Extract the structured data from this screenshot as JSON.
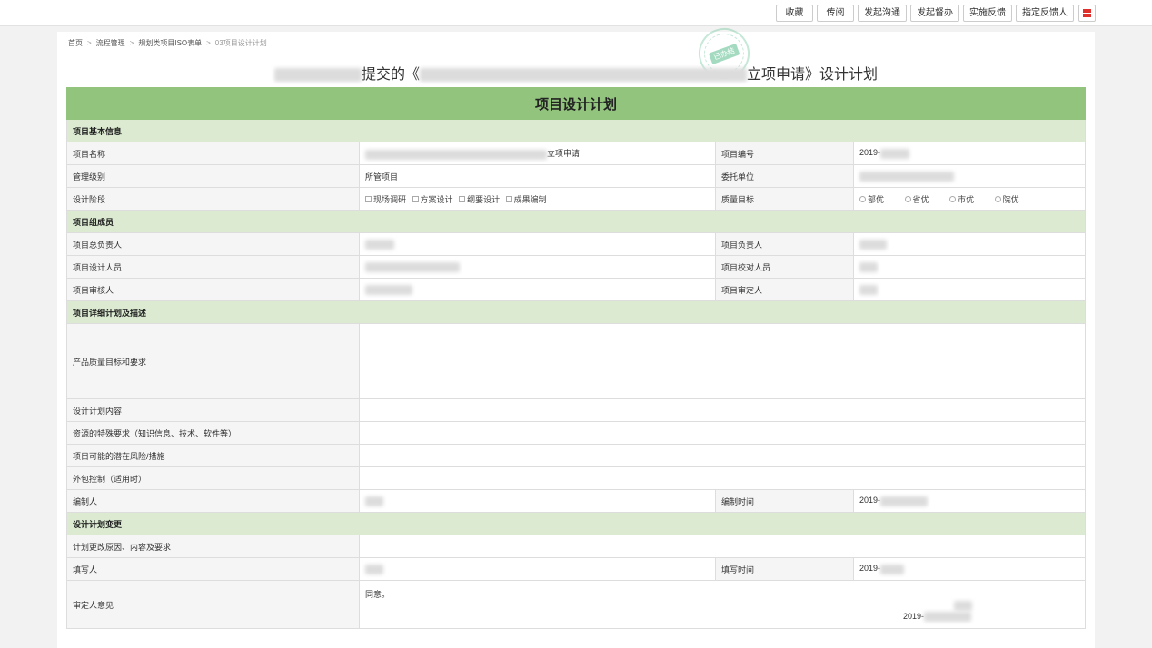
{
  "toolbar": {
    "buttons": [
      "收藏",
      "传阅",
      "发起沟通",
      "发起督办",
      "实施反馈",
      "指定反馈人"
    ]
  },
  "breadcrumb": {
    "items": [
      "首页",
      "流程管理",
      "规划类项目ISO表单",
      "03项目设计计划"
    ],
    "separator": ">"
  },
  "stamp": {
    "text": "已办结"
  },
  "header": {
    "prefix_text": "提交的《",
    "suffix_text": "立项申请》设计计划"
  },
  "form": {
    "caption": "项目设计计划",
    "sections": {
      "basic": "项目基本信息",
      "members": "项目组成员",
      "detail": "项目详细计划及描述",
      "change": "设计计划变更"
    },
    "labels": {
      "project_name": "项目名称",
      "project_no": "项目编号",
      "mgmt_level": "管理级别",
      "client": "委托单位",
      "design_stage": "设计阶段",
      "quality_target": "质量目标",
      "chief_lead": "项目总负责人",
      "project_lead": "项目负责人",
      "designers": "项目设计人员",
      "checkers": "项目校对人员",
      "reviewer": "项目审核人",
      "approver": "项目审定人",
      "quality_req": "产品质量目标和要求",
      "plan_content": "设计计划内容",
      "resource_req": "资源的特殊要求（知识信息、技术、软件等）",
      "risk": "项目可能的潜在风险/措施",
      "outsourcing": "外包控制（适用时）",
      "compiler": "编制人",
      "compile_time": "编制时间",
      "change_reason": "计划更改原因、内容及要求",
      "filler": "填写人",
      "fill_time": "填写时间",
      "approver_opinion": "审定人意见"
    },
    "values": {
      "project_name_suffix": "立项申请",
      "project_no_prefix": "2019-",
      "mgmt_level": "所管项目",
      "compile_time_prefix": "2019-",
      "fill_time_prefix": "2019-",
      "opinion_text": "同意。",
      "opinion_date_prefix": "2019-"
    },
    "design_stage_options": [
      "现场调研",
      "方案设计",
      "纲要设计",
      "成果编制"
    ],
    "quality_options": [
      "部优",
      "省优",
      "市优",
      "院优"
    ]
  },
  "colors": {
    "caption_bg": "#92c47d",
    "section_bg": "#dbead1",
    "label_bg": "#f5f5f5",
    "grid_icon": "#e0302c"
  }
}
